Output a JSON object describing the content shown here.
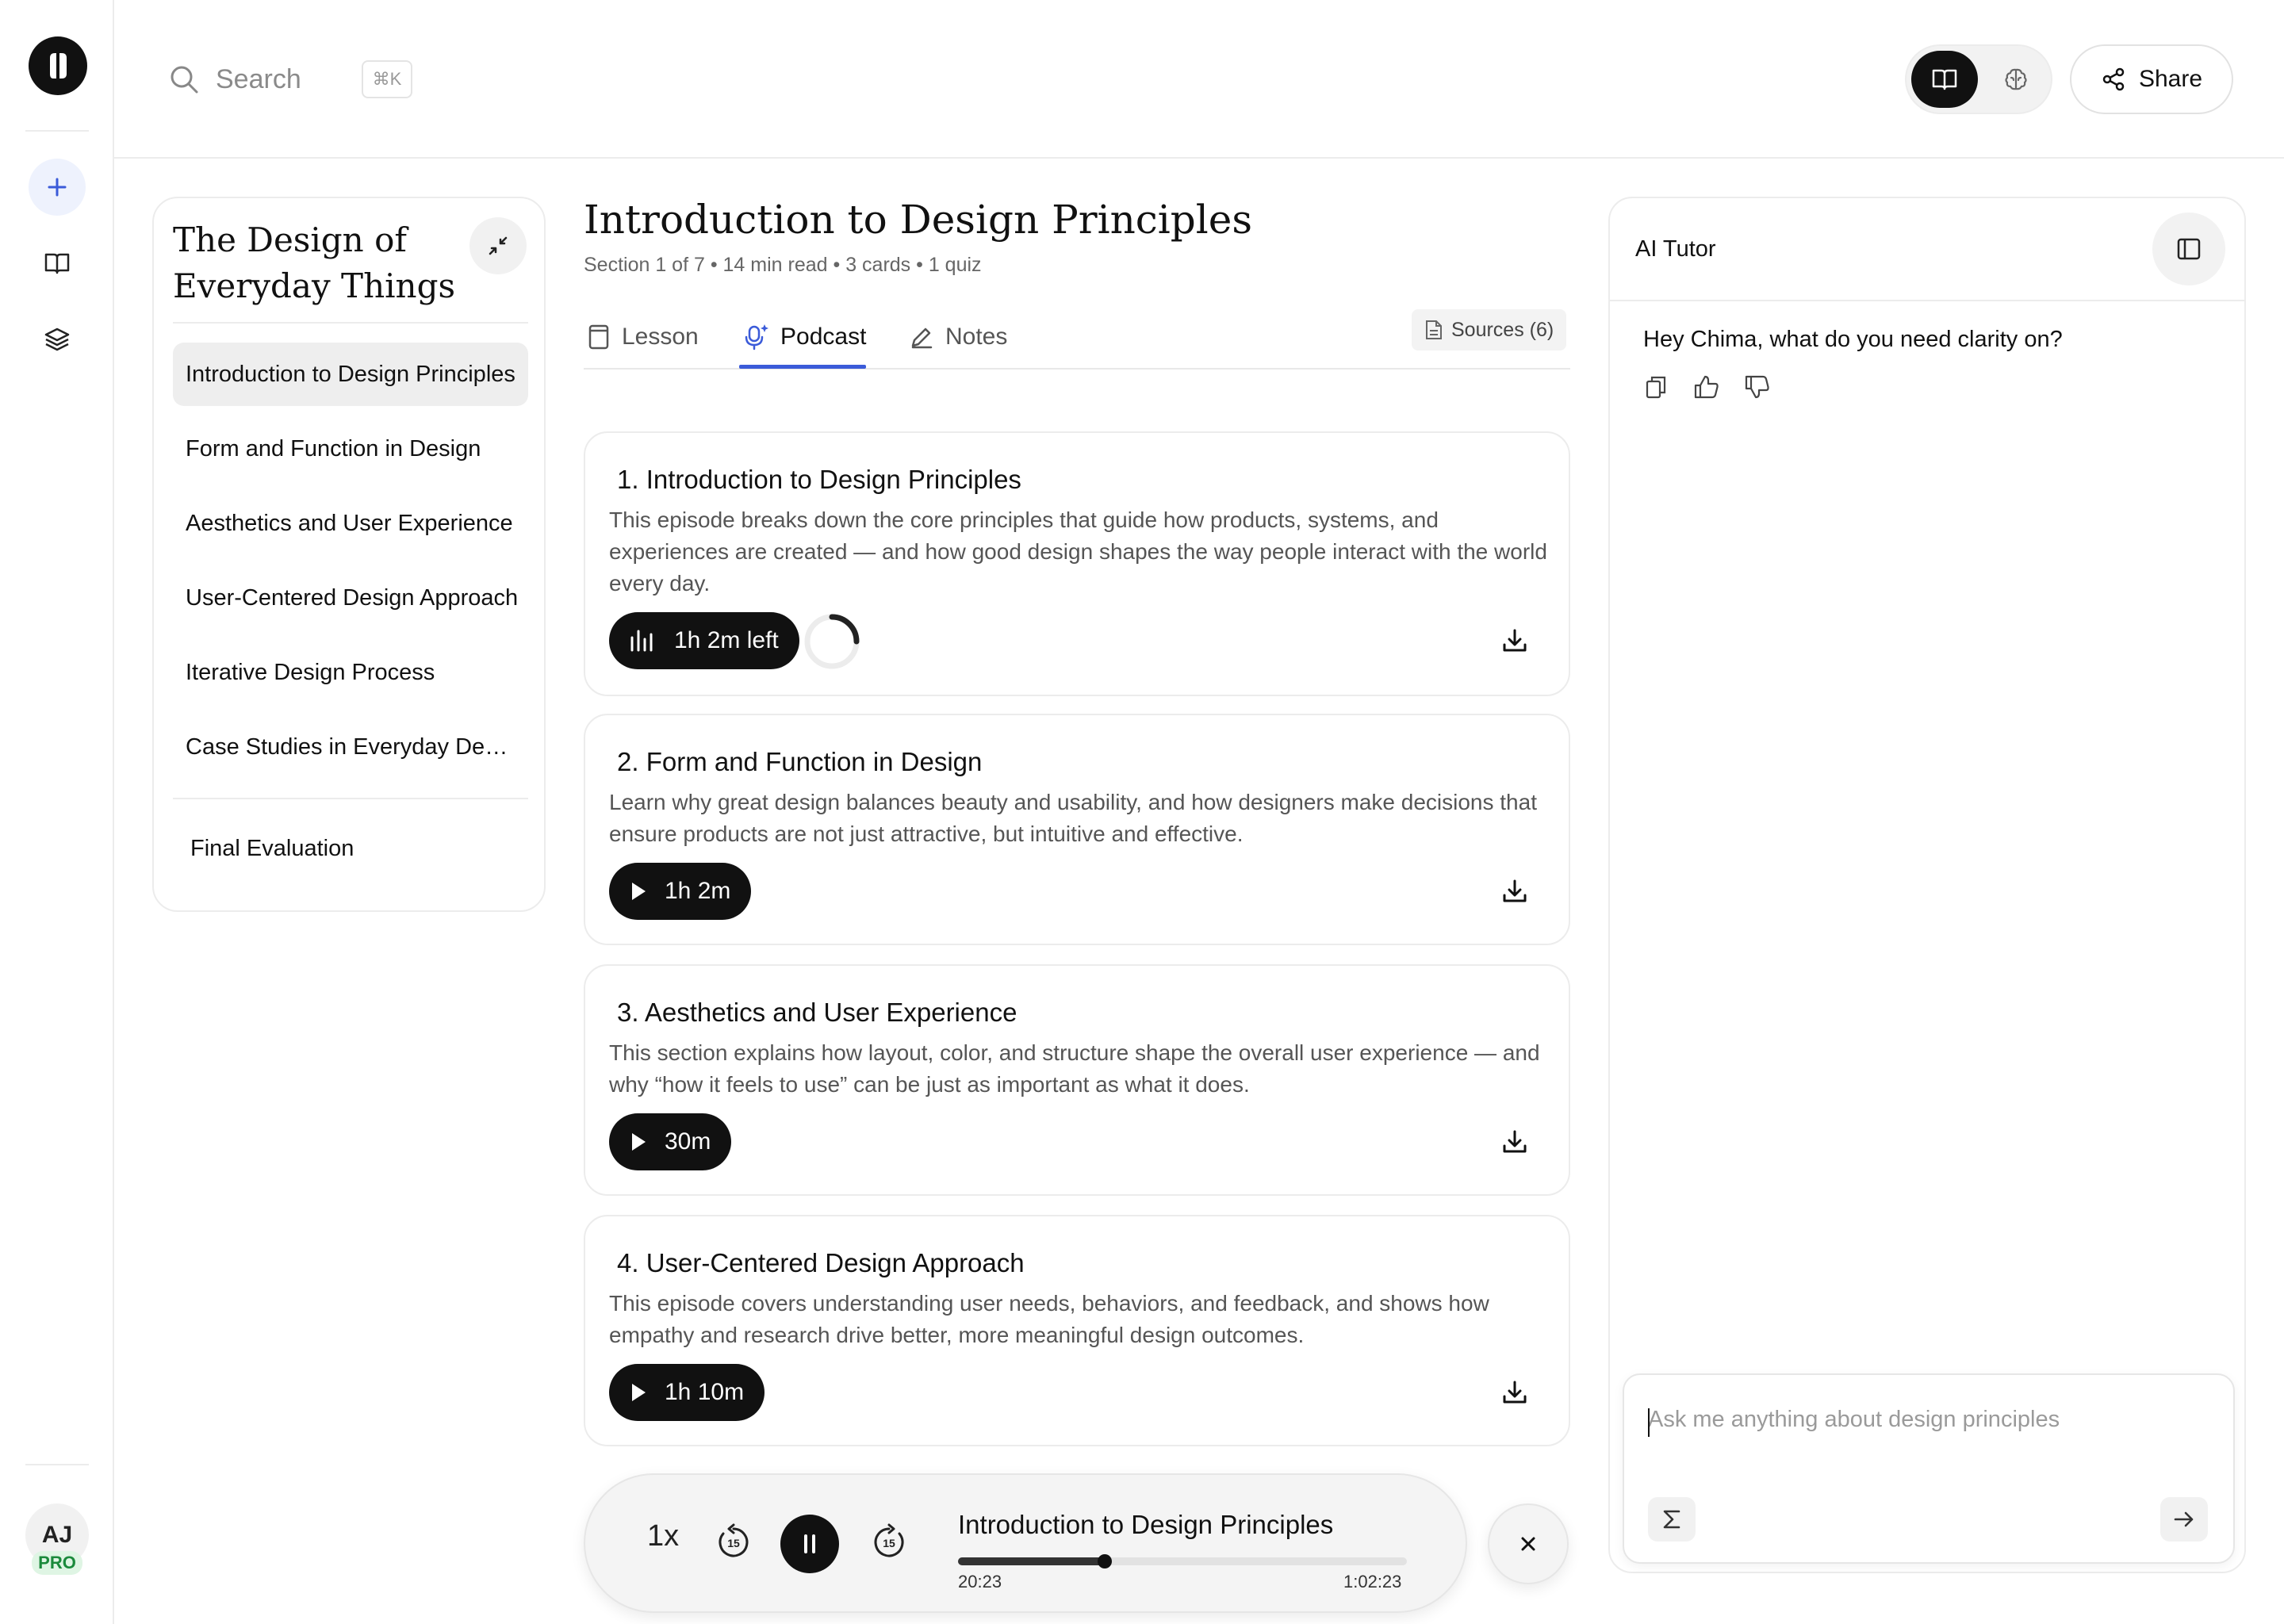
{
  "search": {
    "placeholder": "Search",
    "shortcut": "⌘K"
  },
  "header": {
    "share_label": "Share",
    "active_mode": "book"
  },
  "rail": {
    "avatar_initials": "AJ",
    "plan_badge": "PRO"
  },
  "outline": {
    "title": "The Design of Everyday Things",
    "items": [
      {
        "label": "Introduction to Design Principles",
        "active": true
      },
      {
        "label": "Form and Function in Design",
        "active": false
      },
      {
        "label": "Aesthetics and User Experience",
        "active": false
      },
      {
        "label": "User-Centered Design Approach",
        "active": false
      },
      {
        "label": "Iterative Design Process",
        "active": false
      },
      {
        "label": "Case Studies in Everyday Design",
        "active": false
      }
    ],
    "final_label": "Final Evaluation"
  },
  "main": {
    "title": "Introduction to Design Principles",
    "meta": "Section 1 of 7 • 14 min read • 3 cards • 1 quiz",
    "tabs": [
      {
        "label": "Lesson",
        "icon": "book-page-icon",
        "active": false
      },
      {
        "label": "Podcast",
        "icon": "sparkle-mic-icon",
        "active": true
      },
      {
        "label": "Notes",
        "icon": "pencil-icon",
        "active": false
      }
    ],
    "sources_label": "Sources (6)"
  },
  "episodes": [
    {
      "title": "1. Introduction to Design Principles",
      "description": "This episode breaks down the core principles that guide how products, systems, and experiences are created — and how good design shapes the way people interact with the world every day.",
      "button_label": "1h 2m left",
      "state": "playing",
      "loading": true
    },
    {
      "title": "2. Form and Function in Design",
      "description": "Learn why great design balances beauty and usability, and how designers make decisions that ensure products are not just attractive, but intuitive and effective.",
      "button_label": "1h 2m",
      "state": "paused"
    },
    {
      "title": "3. Aesthetics and User Experience",
      "description": "This section explains how layout, color, and structure shape the overall user experience — and why “how it feels to use” can be just as important as what it does.",
      "button_label": "30m",
      "state": "paused"
    },
    {
      "title": "4. User-Centered Design Approach",
      "description": "This episode covers understanding user needs, behaviors, and feedback, and shows how empathy and research drive better, more meaningful design outcomes.",
      "button_label": "1h 10m",
      "state": "paused"
    }
  ],
  "player": {
    "speed": "1x",
    "skip_back": "15",
    "skip_forward": "15",
    "title": "Introduction to Design Principles",
    "current_time": "20:23",
    "total_time": "1:02:23",
    "progress_fraction": 0.3267
  },
  "tutor": {
    "title": "AI Tutor",
    "greeting": "Hey Chima, what do you need clarity on?",
    "input_placeholder": "Ask me anything about design principles"
  },
  "colors": {
    "accent": "#3b5bd9",
    "primary_dark": "#111111",
    "pro_green": "#1b8a3c"
  }
}
